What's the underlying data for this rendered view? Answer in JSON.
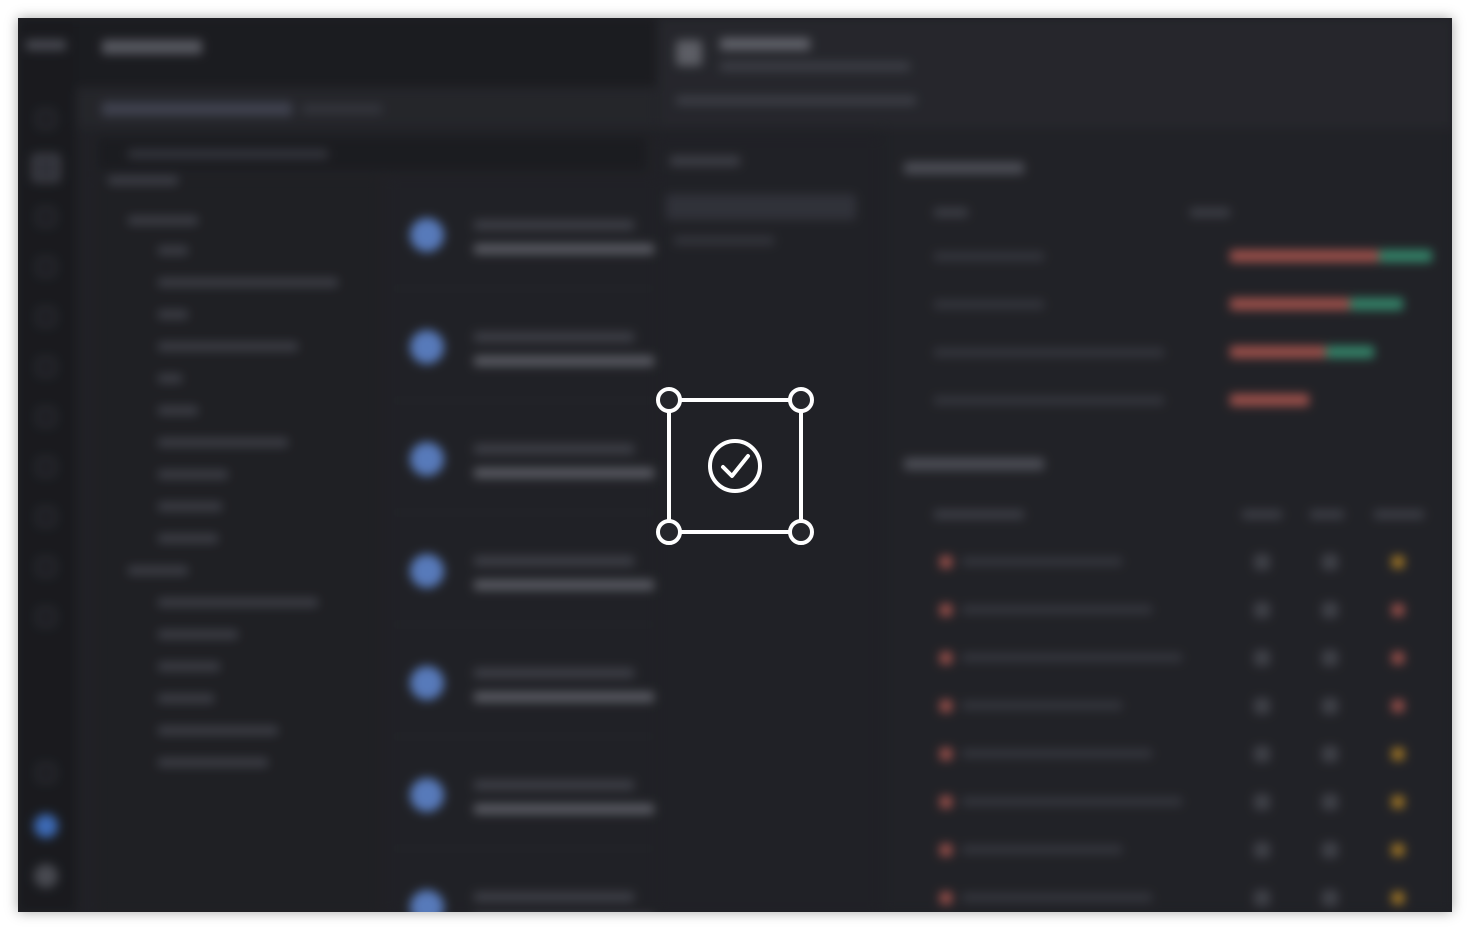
{
  "window": {
    "title": "",
    "background": "#25262b"
  },
  "overlay": {
    "icon": "selection-check-icon",
    "icon_color": "#ffffff",
    "state": "content-blurred"
  },
  "colors": {
    "bar_bad": "#c9645c",
    "bar_good": "#3fa984",
    "accent": "#6e9cf0",
    "warning": "#d49a2a"
  },
  "chart_rows": [
    {
      "red": 0.62,
      "green": 0.22
    },
    {
      "red": 0.5,
      "green": 0.22
    },
    {
      "red": 0.4,
      "green": 0.2
    },
    {
      "red": 0.33,
      "green": 0.0
    }
  ],
  "table_rows": [
    {
      "status": "warning"
    },
    {
      "status": "bad"
    },
    {
      "status": "bad"
    },
    {
      "status": "bad"
    },
    {
      "status": "warning"
    },
    {
      "status": "warning"
    },
    {
      "status": "warning"
    },
    {
      "status": "warning"
    }
  ]
}
